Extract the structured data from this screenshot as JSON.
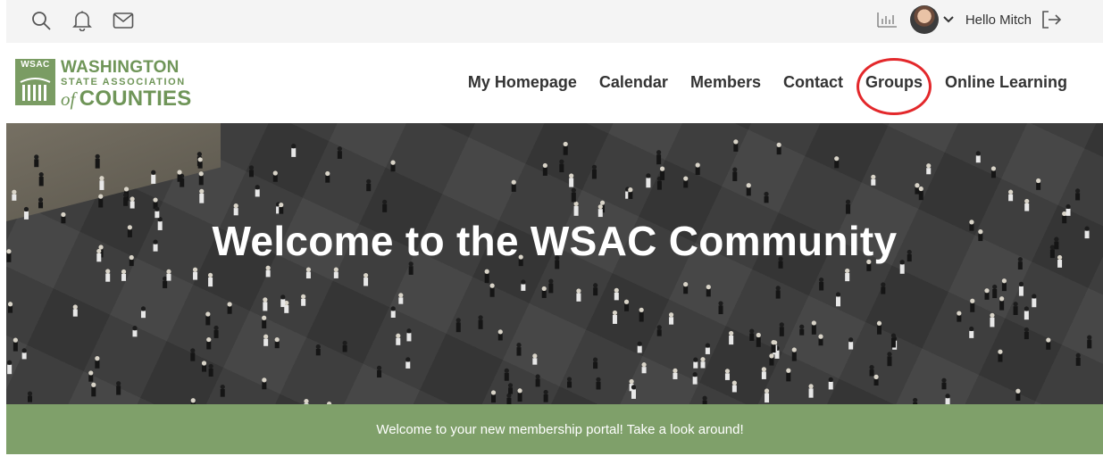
{
  "utility_bar": {
    "icons": [
      "search-icon",
      "bell-icon",
      "mail-icon",
      "analytics-icon",
      "chevron-down-icon",
      "logout-icon"
    ],
    "greeting": "Hello Mitch"
  },
  "logo": {
    "tag": "WSAC",
    "line1": "WASHINGTON",
    "line2": "STATE ASSOCIATION",
    "line3_of": "of",
    "line3": "COUNTIES"
  },
  "nav": {
    "items": [
      {
        "label": "My Homepage"
      },
      {
        "label": "Calendar"
      },
      {
        "label": "Members"
      },
      {
        "label": "Contact"
      },
      {
        "label": "Groups"
      },
      {
        "label": "Online Learning"
      }
    ]
  },
  "hero": {
    "title": "Welcome to the WSAC Community"
  },
  "banner": {
    "text": "Welcome to your new membership portal! Take a look around!"
  },
  "colors": {
    "brand_green": "#7a9c63",
    "banner_green": "#7fa06a",
    "highlight_red": "#e3282b"
  }
}
